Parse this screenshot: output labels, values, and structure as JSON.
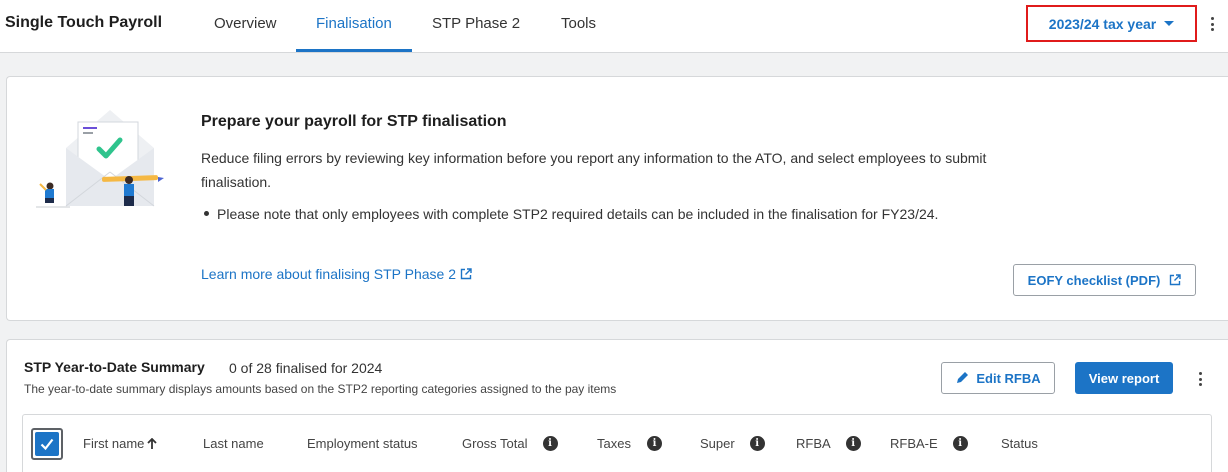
{
  "header": {
    "app_title": "Single Touch Payroll",
    "tabs": [
      {
        "label": "Overview"
      },
      {
        "label": "Finalisation"
      },
      {
        "label": "STP Phase 2"
      },
      {
        "label": "Tools"
      }
    ],
    "active_tab": "Finalisation",
    "tax_year_label": "2023/24 tax year"
  },
  "finalisation_card": {
    "heading": "Prepare your payroll for STP finalisation",
    "description": "Reduce filing errors by reviewing key information before you report any information to the ATO, and select employees to submit finalisation.",
    "bullet": "Please note that only employees with complete STP2 required details can be included in the finalisation for FY23/24.",
    "learn_link": "Learn more about finalising STP Phase 2",
    "eofy_button": "EOFY checklist (PDF)"
  },
  "summary_card": {
    "title": "STP Year-to-Date Summary",
    "count_text": "0 of 28 finalised for 2024",
    "subtitle": "The year-to-date summary displays amounts based on the STP2 reporting categories assigned to the pay items",
    "edit_button": "Edit RFBA",
    "view_button": "View report",
    "select_all_checked": true,
    "columns": [
      "First name",
      "Last name",
      "Employment status",
      "Gross Total",
      "Taxes",
      "Super",
      "RFBA",
      "RFBA-E",
      "Status"
    ]
  },
  "colors": {
    "accent": "#1c74c6",
    "highlight_border": "#e01b1b"
  }
}
